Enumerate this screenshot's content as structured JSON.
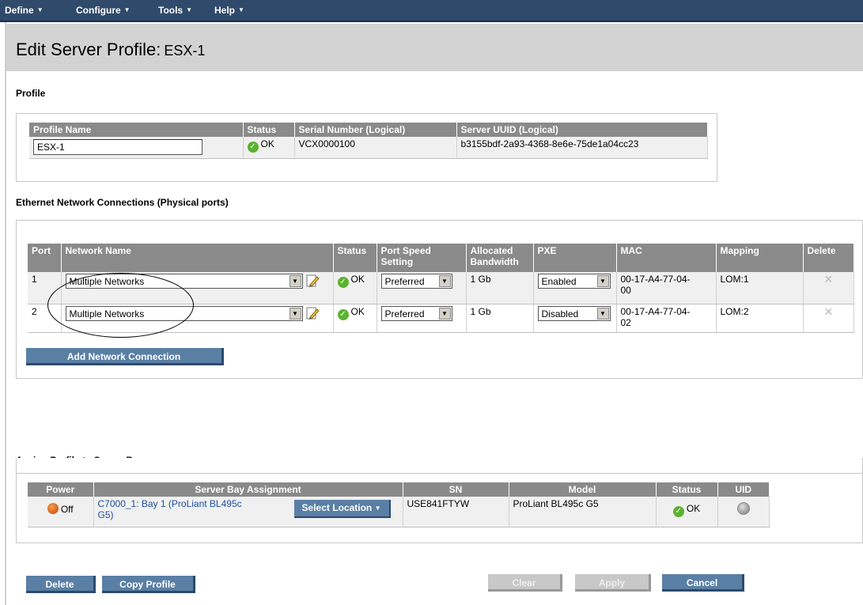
{
  "menu": {
    "define": "Define",
    "configure": "Configure",
    "tools": "Tools",
    "help": "Help"
  },
  "page": {
    "title": "Edit Server Profile:",
    "profile_name": "ESX-1"
  },
  "profile_section": {
    "title": "Profile",
    "headers": [
      "Profile Name",
      "Status",
      "Serial Number (Logical)",
      "Server UUID (Logical)"
    ],
    "name_value": "ESX-1",
    "status": "OK",
    "serial": "VCX0000100",
    "uuid": "b3155bdf-2a93-4368-8e6e-75de1a04cc23"
  },
  "ethernet_section": {
    "title": "Ethernet Network Connections (Physical ports)",
    "headers": {
      "port": "Port",
      "network": "Network Name",
      "status": "Status",
      "speed_1": "Port Speed",
      "speed_2": "Setting",
      "bw_1": "Allocated",
      "bw_2": "Bandwidth",
      "pxe": "PXE",
      "mac": "MAC",
      "mapping": "Mapping",
      "delete": "Delete"
    },
    "rows": [
      {
        "port": "1",
        "network": "Multiple Networks",
        "status": "OK",
        "speed": "Preferred",
        "bandwidth": "1 Gb",
        "pxe": "Enabled",
        "mac_1": "00-17-A4-77-04-",
        "mac_2": "00",
        "mapping": "LOM:1"
      },
      {
        "port": "2",
        "network": "Multiple Networks",
        "status": "OK",
        "speed": "Preferred",
        "bandwidth": "1 Gb",
        "pxe": "Disabled",
        "mac_1": "00-17-A4-77-04-",
        "mac_2": "02",
        "mapping": "LOM:2"
      }
    ],
    "add_button": "Add Network Connection"
  },
  "bay_section": {
    "title": "Assign Profile to Server Bay",
    "headers": [
      "Power",
      "Server Bay Assignment",
      "SN",
      "Model",
      "Status",
      "UID"
    ],
    "power": "Off",
    "assignment_1": "C7000_1: Bay 1 (ProLiant BL495c",
    "assignment_2": "G5)",
    "select_location": "Select Location",
    "sn": "USE841FTYW",
    "model": "ProLiant BL495c G5",
    "status": "OK"
  },
  "buttons": {
    "delete": "Delete",
    "copy": "Copy Profile",
    "clear": "Clear",
    "apply": "Apply",
    "cancel": "Cancel"
  },
  "colors": {
    "accent": "#5a7fa5",
    "header_bar": "#2f4a6b",
    "table_header": "#8a8a8a",
    "ok_green": "#5cb230"
  }
}
